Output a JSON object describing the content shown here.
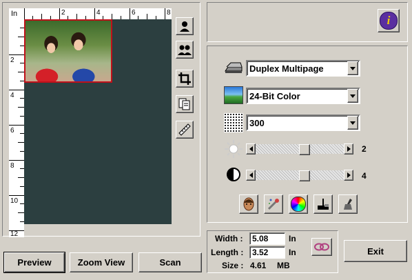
{
  "ruler": {
    "unit": "In",
    "top_labels": [
      "2",
      "4",
      "6",
      "8"
    ],
    "left_labels": [
      "2",
      "4",
      "6",
      "8",
      "10",
      "12"
    ]
  },
  "tools": {
    "icons": [
      "portrait-select-icon",
      "group-select-icon",
      "crop-icon",
      "multi-page-icon",
      "ruler-icon"
    ]
  },
  "info_button_icon": "info-icon",
  "settings": {
    "scan_mode": "Duplex Multipage",
    "image_type": "24-Bit Color",
    "resolution": "300",
    "brightness": {
      "value": "2",
      "level": 0.56
    },
    "contrast": {
      "value": "4",
      "level": 0.56
    }
  },
  "adjust_icons": [
    "auto-adjust-icon",
    "descreen-icon",
    "color-balance-icon",
    "shadow-highlight-icon",
    "color-dropper-icon"
  ],
  "dimensions": {
    "width_label": "Width :",
    "width_value": "5.08",
    "width_unit": "In",
    "length_label": "Length :",
    "length_value": "3.52",
    "length_unit": "In",
    "size_label": "Size :",
    "size_value": "4.61",
    "size_unit": "MB"
  },
  "buttons": {
    "preview": "Preview",
    "zoom_view": "Zoom View",
    "scan": "Scan",
    "exit": "Exit"
  },
  "colors": {
    "preview_background": "#2c3f40",
    "selection_border": "#c0101a",
    "info_button": "#5a2fa0"
  }
}
